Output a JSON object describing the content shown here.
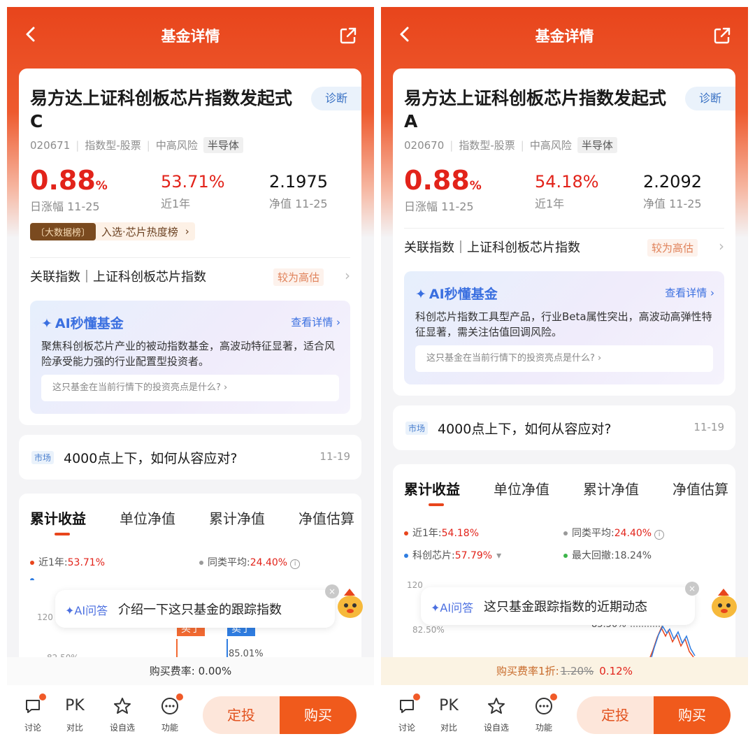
{
  "left": {
    "header": {
      "title": "基金详情"
    },
    "fund": {
      "name": "易方达上证科创板芯片指数发起式C",
      "diagnose_label": "诊断",
      "code": "020671",
      "type": "指数型-股票",
      "risk": "中高风险",
      "sector": "半导体"
    },
    "stats": {
      "daily_change": "0.88",
      "daily_unit": "%",
      "daily_label": "日涨幅 11-25",
      "year_return": "53.71%",
      "year_label": "近1年",
      "nav": "2.1975",
      "nav_label": "净值 11-25"
    },
    "badge": {
      "tag": "〔大数据榜〕",
      "text": "入选·芯片热度榜",
      "chevron": "›"
    },
    "index": {
      "label": "关联指数｜上证科创板芯片指数",
      "level": "较为高估",
      "chevron": "›"
    },
    "ai": {
      "title": "AI秒懂基金",
      "more": "查看详情 ›",
      "desc": "聚焦科创板芯片产业的被动指数基金，高波动特征显著，适合风险承受能力强的行业配置型投资者。",
      "question": "这只基金在当前行情下的投资亮点是什么? ›"
    },
    "news": {
      "tag": "市场",
      "title": "4000点上下，如何从容应对?",
      "date": "11-19"
    },
    "tabs": [
      "累计收益",
      "单位净值",
      "累计净值",
      "净值估算"
    ],
    "legend": {
      "year": "近1年:",
      "year_val": "53.71%",
      "peer": "同类平均:",
      "peer_val": "24.40%"
    },
    "chart_labels": {
      "y1": "120",
      "buy": "买了",
      "sell": "卖了",
      "peak": "85.01%",
      "y2": "82.50%"
    },
    "chat": {
      "label": "✦AI问答",
      "question": "介绍一下这只基金的跟踪指数",
      "close": "×"
    },
    "fee": {
      "label": "购买费率: 0.00%"
    },
    "nav_items": [
      {
        "label": "讨论",
        "icon": "speech-bubble-icon"
      },
      {
        "label": "对比",
        "icon": "pk-icon",
        "glyph": "PK"
      },
      {
        "label": "设自选",
        "icon": "star-icon"
      },
      {
        "label": "功能",
        "icon": "more-icon"
      }
    ],
    "actions": {
      "sip": "定投",
      "buy": "购买"
    }
  },
  "right": {
    "header": {
      "title": "基金详情"
    },
    "fund": {
      "name": "易方达上证科创板芯片指数发起式A",
      "diagnose_label": "诊断",
      "code": "020670",
      "type": "指数型-股票",
      "risk": "中高风险",
      "sector": "半导体"
    },
    "stats": {
      "daily_change": "0.88",
      "daily_unit": "%",
      "daily_label": "日涨幅 11-25",
      "year_return": "54.18%",
      "year_label": "近1年",
      "nav": "2.2092",
      "nav_label": "净值 11-25"
    },
    "index": {
      "label": "关联指数｜上证科创板芯片指数",
      "level": "较为高估",
      "chevron": "›"
    },
    "ai": {
      "title": "AI秒懂基金",
      "more": "查看详情 ›",
      "desc": "科创芯片指数工具型产品，行业Beta属性突出，高波动高弹性特征显著，需关注估值回调风险。",
      "question": "这只基金在当前行情下的投资亮点是什么? ›"
    },
    "news": {
      "tag": "市场",
      "title": "4000点上下，如何从容应对?",
      "date": "11-19"
    },
    "tabs": [
      "累计收益",
      "单位净值",
      "累计净值",
      "净值估算"
    ],
    "legend": {
      "year": "近1年:",
      "year_val": "54.18%",
      "peer": "同类平均:",
      "peer_val": "24.40%",
      "index": "科创芯片:",
      "index_val": "57.79%",
      "drawdown": "最大回撤:",
      "drawdown_val": "18.24%"
    },
    "chart_labels": {
      "y1": "120",
      "peak": "85.50%",
      "y2": "82.50%"
    },
    "chat": {
      "label": "✦AI问答",
      "question": "这只基金跟踪指数的近期动态",
      "close": "×"
    },
    "fee": {
      "label": "购买费率1折:",
      "old": "1.20%",
      "new": "0.12%"
    },
    "nav_items": [
      {
        "label": "讨论",
        "icon": "speech-bubble-icon"
      },
      {
        "label": "对比",
        "icon": "pk-icon",
        "glyph": "PK"
      },
      {
        "label": "设自选",
        "icon": "star-icon"
      },
      {
        "label": "功能",
        "icon": "more-icon"
      }
    ],
    "actions": {
      "sip": "定投",
      "buy": "购买"
    }
  },
  "colors": {
    "brand": "#e8451c",
    "rise": "#e2231a",
    "ai_blue": "#3a6fe0",
    "index_blue": "#2f7de1",
    "drawdown_green": "#3cb54a",
    "peer_gray": "#999999"
  }
}
